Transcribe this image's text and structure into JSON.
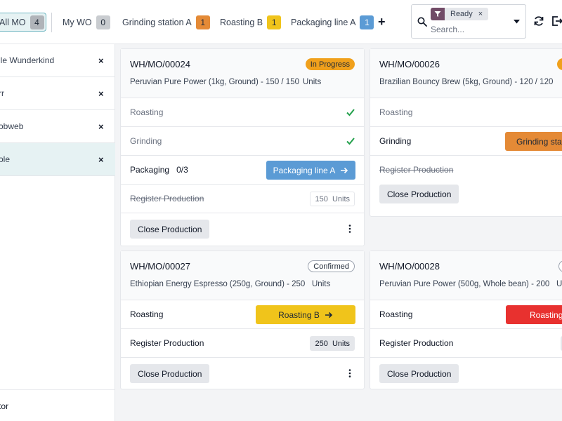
{
  "topbar": {
    "tabs": [
      {
        "label": "All MO",
        "count": "4"
      },
      {
        "label": "My WO",
        "count": "0"
      },
      {
        "label": "Grinding station A",
        "count": "1"
      },
      {
        "label": "Roasting B",
        "count": "1"
      },
      {
        "label": "Packaging line A",
        "count": "1"
      }
    ],
    "add_label": "+",
    "search": {
      "facet": "Ready",
      "facet_remove": "×",
      "placeholder": "Search..."
    }
  },
  "sidebar": {
    "items": [
      {
        "label": "lle Wunderkind",
        "remove": "×"
      },
      {
        "label": "rr",
        "remove": "×"
      },
      {
        "label": "obweb",
        "remove": "×"
      },
      {
        "label": "ole",
        "remove": "×"
      }
    ],
    "bottom": "tor"
  },
  "cards": [
    {
      "name": "WH/MO/00024",
      "status": "In Progress",
      "product": "Peruvian Pure Power (1kg, Ground) - 150 / 150",
      "units": "Units",
      "rows": [
        {
          "label": "Roasting",
          "state": "done"
        },
        {
          "label": "Grinding",
          "state": "done"
        },
        {
          "label": "Packaging",
          "progress": "0/3",
          "button": "Packaging line A"
        },
        {
          "label": "Register Production",
          "qty": "150",
          "qty_units": "Units"
        }
      ],
      "close": "Close Production"
    },
    {
      "name": "WH/MO/00026",
      "product": "Brazilian Bouncy Brew (5kg, Ground) - 120 / 120",
      "rows": [
        {
          "label": "Roasting"
        },
        {
          "label": "Grinding",
          "button": "Grinding stat"
        },
        {
          "label": "Register Production"
        }
      ],
      "close": "Close Production"
    },
    {
      "name": "WH/MO/00027",
      "status": "Confirmed",
      "product": "Ethiopian Energy Espresso (250g, Ground) - 250",
      "units": "Units",
      "rows": [
        {
          "label": "Roasting",
          "button": "Roasting B"
        },
        {
          "label": "Register Production",
          "qty": "250",
          "qty_units": "Units"
        }
      ],
      "close": "Close Production"
    },
    {
      "name": "WH/MO/00028",
      "product": "Peruvian Pure Power (500g, Whole bean) - 200",
      "units": "U",
      "rows": [
        {
          "label": "Roasting",
          "button": "Roasting"
        },
        {
          "label": "Register Production"
        }
      ],
      "close": "Close Production"
    }
  ],
  "colors": {
    "accent": "#71b7c2",
    "in_progress": "#f0a01c",
    "packaging": "#5b9bd5",
    "roasting": "#f0c41b",
    "grinding": "#e48a36",
    "danger": "#e8312f",
    "check": "#22a04b",
    "filter": "#714b67"
  }
}
